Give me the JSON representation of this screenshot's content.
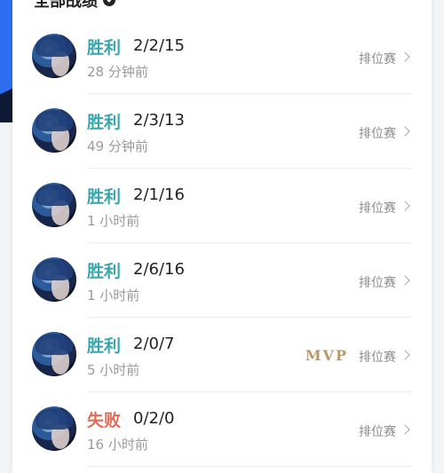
{
  "header": {
    "title": "全部战绩"
  },
  "matches": [
    {
      "result": "胜利",
      "outcome": "win",
      "kda": "2/2/15",
      "time": "28 分钟前",
      "mvp": "",
      "mode": "排位赛"
    },
    {
      "result": "胜利",
      "outcome": "win",
      "kda": "2/3/13",
      "time": "49 分钟前",
      "mvp": "",
      "mode": "排位赛"
    },
    {
      "result": "胜利",
      "outcome": "win",
      "kda": "2/1/16",
      "time": "1 小时前",
      "mvp": "",
      "mode": "排位赛"
    },
    {
      "result": "胜利",
      "outcome": "win",
      "kda": "2/6/16",
      "time": "1 小时前",
      "mvp": "",
      "mode": "排位赛"
    },
    {
      "result": "胜利",
      "outcome": "win",
      "kda": "2/0/7",
      "time": "5 小时前",
      "mvp": "MVP",
      "mode": "排位赛"
    },
    {
      "result": "失败",
      "outcome": "loss",
      "kda": "0/2/0",
      "time": "16 小时前",
      "mvp": "",
      "mode": "排位赛"
    }
  ],
  "colors": {
    "win": "#3aa6ad",
    "loss": "#e06b57",
    "mvp": "#b6986a"
  }
}
